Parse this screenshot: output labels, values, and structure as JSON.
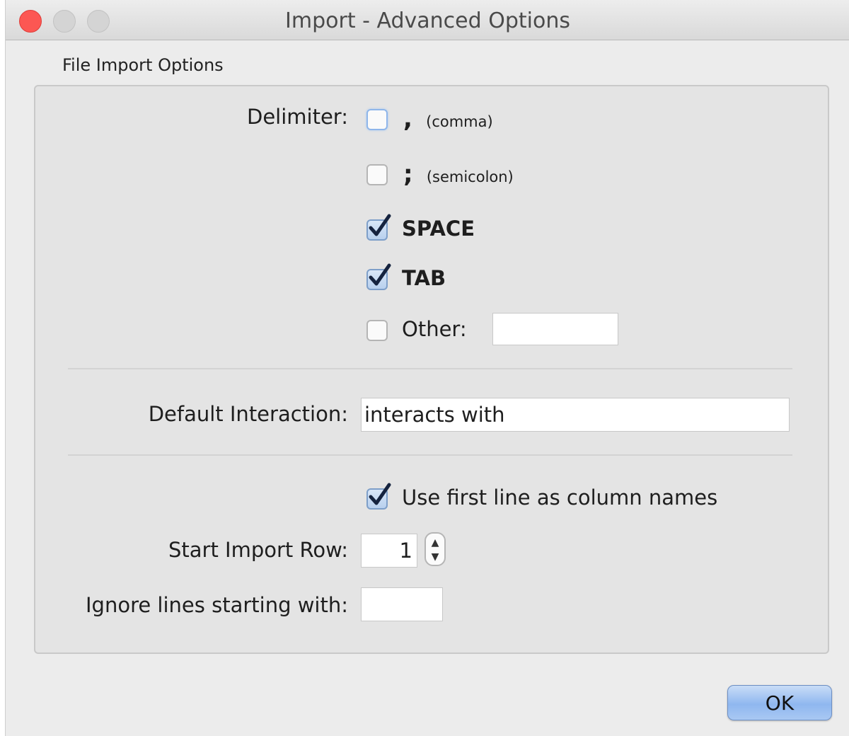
{
  "window": {
    "title": "Import - Advanced Options"
  },
  "section": {
    "label": "File Import Options"
  },
  "delimiter": {
    "label": "Delimiter:",
    "options": [
      {
        "symbol": ",",
        "note": "(comma)",
        "checked": false
      },
      {
        "symbol": ";",
        "note": "(semicolon)",
        "checked": false
      },
      {
        "label": "SPACE",
        "checked": true
      },
      {
        "label": "TAB",
        "checked": true
      },
      {
        "label": "Other:",
        "checked": false,
        "value": ""
      }
    ]
  },
  "default_interaction": {
    "label": "Default Interaction:",
    "value": "interacts with"
  },
  "first_line": {
    "label": "Use first line as column names",
    "checked": true
  },
  "start_row": {
    "label": "Start Import Row:",
    "value": "1"
  },
  "ignore_lines": {
    "label": "Ignore lines starting with:",
    "value": ""
  },
  "buttons": {
    "ok": "OK"
  },
  "colors": {
    "close": "#fc5753",
    "accent": "#8fb7ef"
  }
}
